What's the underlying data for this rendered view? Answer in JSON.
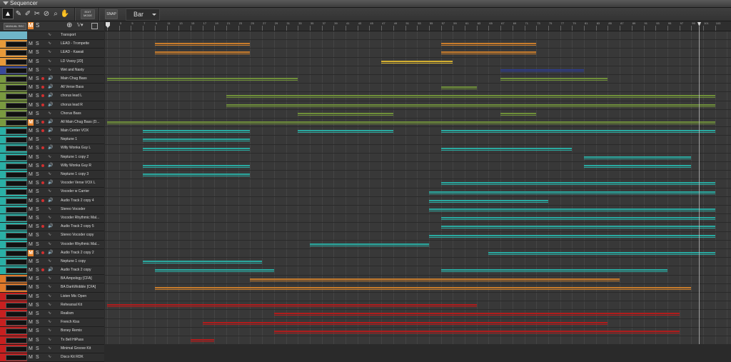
{
  "window": {
    "title": "Sequencer"
  },
  "toolbar": {
    "edit_mode_label": "EDIT\nMODE",
    "snap_label": "SNAP",
    "snap_value": "Bar"
  },
  "header": {
    "manual_rec_label": "MANUAL REC",
    "mute_label": "M",
    "solo_label": "S"
  },
  "ruler": {
    "bars": [
      "1",
      "3",
      "5",
      "7",
      "9",
      "11",
      "13",
      "15",
      "17",
      "19",
      "21",
      "23",
      "25",
      "27",
      "29",
      "31",
      "33",
      "35",
      "37",
      "39",
      "41",
      "43",
      "45",
      "47",
      "49",
      "51",
      "53",
      "55",
      "57",
      "59",
      "61",
      "63",
      "65",
      "67",
      "69",
      "71",
      "73",
      "75",
      "77",
      "79",
      "81",
      "83",
      "85",
      "87",
      "89",
      "91",
      "93",
      "95",
      "97",
      "99",
      "101",
      "103"
    ]
  },
  "colors": {
    "accent": "#e8842c",
    "teal": "#2aa9a0",
    "green": "#6f8f3a",
    "orange": "#c87c2c",
    "red": "#b01c1c",
    "gold": "#d4b030",
    "navy": "#2d3c88"
  },
  "tracks": [
    {
      "name": "Transport",
      "color": "#6fb5c8",
      "mute": false,
      "rec": false
    },
    {
      "name": "LEAD - Trompette",
      "color": "#e89a3a",
      "mute": false,
      "rec": false
    },
    {
      "name": "LEAD - Kawaii",
      "color": "#e89a3a",
      "mute": false,
      "rec": false
    },
    {
      "name": "LD Voxxy [JD]",
      "color": "#e89a3a",
      "mute": false,
      "rec": false
    },
    {
      "name": "Wet and Nasty",
      "color": "#3a4a9a",
      "mute": false,
      "rec": false
    },
    {
      "name": "Main Chug Bass",
      "color": "#7a9a40",
      "mute": false,
      "rec": true
    },
    {
      "name": "All Verse Bass",
      "color": "#7a9a40",
      "mute": false,
      "rec": true
    },
    {
      "name": "chorus lead L",
      "color": "#7a9a40",
      "mute": false,
      "rec": true
    },
    {
      "name": "chorus lead R",
      "color": "#7a9a40",
      "mute": false,
      "rec": true
    },
    {
      "name": "Chorus Bass",
      "color": "#7a9a40",
      "mute": false,
      "rec": false
    },
    {
      "name": "All Main Chug Bass (D...",
      "color": "#7a9a40",
      "mute": true,
      "rec": true
    },
    {
      "name": "Main Center VOX",
      "color": "#2ab0a6",
      "mute": false,
      "rec": true
    },
    {
      "name": "Neptune 1",
      "color": "#2ab0a6",
      "mute": false,
      "rec": false
    },
    {
      "name": "Willy Wonka Guy L",
      "color": "#2ab0a6",
      "mute": false,
      "rec": true
    },
    {
      "name": "Neptune 1 copy 2",
      "color": "#2ab0a6",
      "mute": false,
      "rec": false
    },
    {
      "name": "Willy Wonka Guy R",
      "color": "#2ab0a6",
      "mute": false,
      "rec": true
    },
    {
      "name": "Neptune 1 copy 3",
      "color": "#2ab0a6",
      "mute": false,
      "rec": false
    },
    {
      "name": "Vocoder Verse VOX L",
      "color": "#2ab0a6",
      "mute": false,
      "rec": true
    },
    {
      "name": "Vocoder w Carrier",
      "color": "#2ab0a6",
      "mute": false,
      "rec": false
    },
    {
      "name": "Audio Track 2 copy 4",
      "color": "#2ab0a6",
      "mute": false,
      "rec": true
    },
    {
      "name": "Stereo Vocoder",
      "color": "#2ab0a6",
      "mute": false,
      "rec": false
    },
    {
      "name": "Vocoder Rhythmic Mal...",
      "color": "#2ab0a6",
      "mute": false,
      "rec": false
    },
    {
      "name": "Audio Track 2 copy 5",
      "color": "#2ab0a6",
      "mute": false,
      "rec": true
    },
    {
      "name": "Stereo Vocoder copy",
      "color": "#2ab0a6",
      "mute": false,
      "rec": false
    },
    {
      "name": "Vocoder Rhythmic Mal...",
      "color": "#2ab0a6",
      "mute": false,
      "rec": false
    },
    {
      "name": "Audio Track 2 copy 2",
      "color": "#2ab0a6",
      "mute": true,
      "rec": true
    },
    {
      "name": "Neptune 1 copy",
      "color": "#2ab0a6",
      "mute": false,
      "rec": false
    },
    {
      "name": "Audio Track 2 copy",
      "color": "#2ab0a6",
      "mute": false,
      "rec": true
    },
    {
      "name": "BA Ampology [CFA]",
      "color": "#e07a2a",
      "mute": false,
      "rec": false
    },
    {
      "name": "BA DarkWobble [CFA]",
      "color": "#e07a2a",
      "mute": false,
      "rec": false
    },
    {
      "name": "Listen Mic Open",
      "color": "#c82020",
      "mute": false,
      "rec": false
    },
    {
      "name": "Rehearsal Kit",
      "color": "#c82020",
      "mute": false,
      "rec": false
    },
    {
      "name": "Realism",
      "color": "#c82020",
      "mute": false,
      "rec": false
    },
    {
      "name": "French Kiss",
      "color": "#c82020",
      "mute": false,
      "rec": false
    },
    {
      "name": "Boney Remix",
      "color": "#c82020",
      "mute": false,
      "rec": false
    },
    {
      "name": "Tx 8ell HiPass",
      "color": "#c82020",
      "mute": false,
      "rec": false
    },
    {
      "name": "Minimal Groove Kit",
      "color": "#c82020",
      "mute": false,
      "rec": false
    },
    {
      "name": "Disco Kit RDK",
      "color": "#c82020",
      "mute": false,
      "rec": false
    }
  ]
}
